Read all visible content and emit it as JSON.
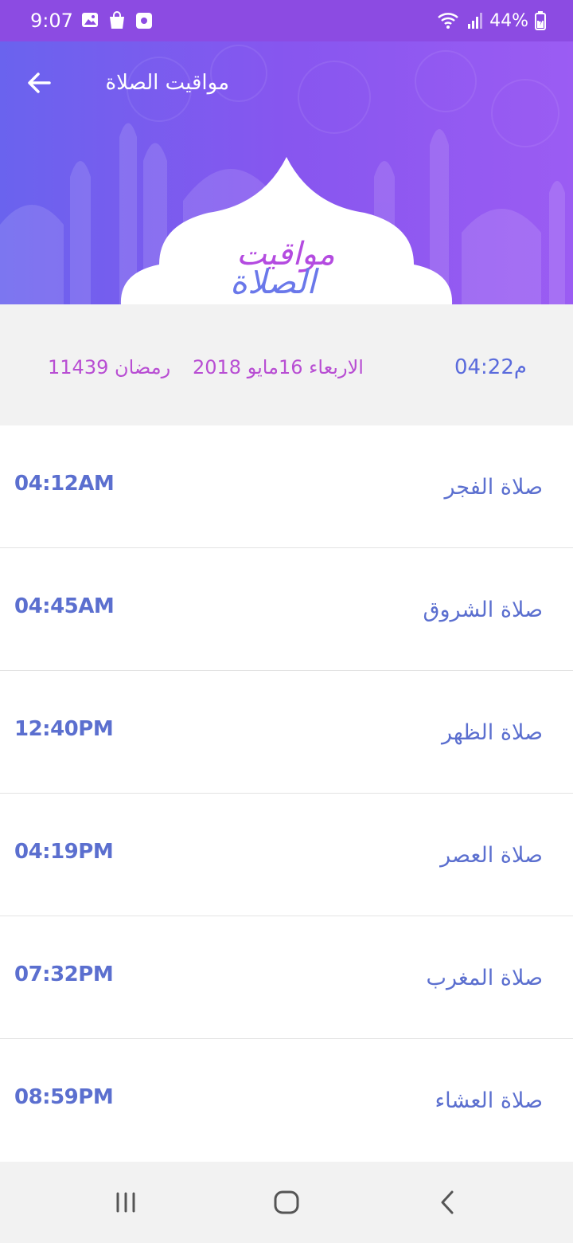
{
  "status_bar": {
    "time": "9:07",
    "battery": "44%",
    "icons": [
      "gallery-icon",
      "shopping-bag-icon",
      "screen-record-icon",
      "wifi-icon",
      "signal-icon",
      "battery-icon"
    ]
  },
  "header": {
    "title": "مواقيت الصلاة",
    "logo_text": "مواقيت الصلاة",
    "back_icon": "arrow-left-icon",
    "colors": {
      "gradient_start": "#6a63ee",
      "gradient_end": "#9b5cf3",
      "logo_primary": "#b44be0",
      "logo_secondary": "#6a78ea"
    }
  },
  "date_strip": {
    "current_time": "04:22م",
    "gregorian": "الاربعاء 16مايو 2018",
    "hijri": "1رمضان 1439"
  },
  "prayers": [
    {
      "name": "صلاة الفجر",
      "time": "04:12AM"
    },
    {
      "name": "صلاة الشروق",
      "time": "04:45AM"
    },
    {
      "name": "صلاة الظهر",
      "time": "12:40PM"
    },
    {
      "name": "صلاة العصر",
      "time": "04:19PM"
    },
    {
      "name": "صلاة المغرب",
      "time": "07:32PM"
    },
    {
      "name": "صلاة العشاء",
      "time": "08:59PM"
    }
  ],
  "nav_bar": {
    "icons": [
      "recent-apps-icon",
      "home-icon",
      "back-icon"
    ]
  },
  "colors": {
    "accent_text": "#5b6fcf",
    "date_text": "#b84ed3",
    "status_bar": "#8c4be2"
  }
}
